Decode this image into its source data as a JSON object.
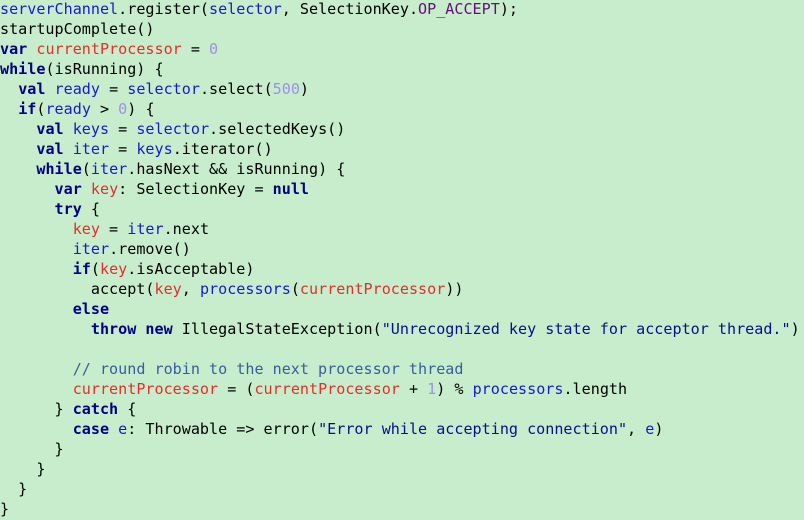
{
  "code_lines": [
    [
      {
        "t": "serverChannel",
        "c": "id"
      },
      {
        "t": ".register(",
        "c": "plain"
      },
      {
        "t": "selector",
        "c": "id"
      },
      {
        "t": ", SelectionKey.",
        "c": "plain"
      },
      {
        "t": "OP_ACCEPT",
        "c": "fld"
      },
      {
        "t": ");",
        "c": "plain"
      }
    ],
    [
      {
        "t": "startupComplete()",
        "c": "plain"
      }
    ],
    [
      {
        "t": "var ",
        "c": "kw"
      },
      {
        "t": "currentProcessor",
        "c": "var"
      },
      {
        "t": " = ",
        "c": "plain"
      },
      {
        "t": "0",
        "c": "num"
      }
    ],
    [
      {
        "t": "while",
        "c": "kw"
      },
      {
        "t": "(isRunning) {",
        "c": "plain"
      }
    ],
    [
      {
        "t": "  ",
        "c": "plain"
      },
      {
        "t": "val ",
        "c": "kw"
      },
      {
        "t": "ready",
        "c": "id"
      },
      {
        "t": " = ",
        "c": "plain"
      },
      {
        "t": "selector",
        "c": "id"
      },
      {
        "t": ".select(",
        "c": "plain"
      },
      {
        "t": "500",
        "c": "num"
      },
      {
        "t": ")",
        "c": "plain"
      }
    ],
    [
      {
        "t": "  ",
        "c": "plain"
      },
      {
        "t": "if",
        "c": "kw"
      },
      {
        "t": "(",
        "c": "plain"
      },
      {
        "t": "ready",
        "c": "id"
      },
      {
        "t": " > ",
        "c": "plain"
      },
      {
        "t": "0",
        "c": "num"
      },
      {
        "t": ") {",
        "c": "plain"
      }
    ],
    [
      {
        "t": "    ",
        "c": "plain"
      },
      {
        "t": "val ",
        "c": "kw"
      },
      {
        "t": "keys",
        "c": "id"
      },
      {
        "t": " = ",
        "c": "plain"
      },
      {
        "t": "selector",
        "c": "id"
      },
      {
        "t": ".selectedKeys()",
        "c": "plain"
      }
    ],
    [
      {
        "t": "    ",
        "c": "plain"
      },
      {
        "t": "val ",
        "c": "kw"
      },
      {
        "t": "iter",
        "c": "id"
      },
      {
        "t": " = ",
        "c": "plain"
      },
      {
        "t": "keys",
        "c": "id"
      },
      {
        "t": ".iterator()",
        "c": "plain"
      }
    ],
    [
      {
        "t": "    ",
        "c": "plain"
      },
      {
        "t": "while",
        "c": "kw"
      },
      {
        "t": "(",
        "c": "plain"
      },
      {
        "t": "iter",
        "c": "id"
      },
      {
        "t": ".hasNext && isRunning) {",
        "c": "plain"
      }
    ],
    [
      {
        "t": "      ",
        "c": "plain"
      },
      {
        "t": "var ",
        "c": "kw"
      },
      {
        "t": "key",
        "c": "var"
      },
      {
        "t": ": SelectionKey = ",
        "c": "plain"
      },
      {
        "t": "null",
        "c": "kw"
      }
    ],
    [
      {
        "t": "      ",
        "c": "plain"
      },
      {
        "t": "try",
        "c": "kw"
      },
      {
        "t": " {",
        "c": "plain"
      }
    ],
    [
      {
        "t": "        ",
        "c": "plain"
      },
      {
        "t": "key",
        "c": "var"
      },
      {
        "t": " = ",
        "c": "plain"
      },
      {
        "t": "iter",
        "c": "id"
      },
      {
        "t": ".next",
        "c": "plain"
      }
    ],
    [
      {
        "t": "        ",
        "c": "plain"
      },
      {
        "t": "iter",
        "c": "id"
      },
      {
        "t": ".remove()",
        "c": "plain"
      }
    ],
    [
      {
        "t": "        ",
        "c": "plain"
      },
      {
        "t": "if",
        "c": "kw"
      },
      {
        "t": "(",
        "c": "plain"
      },
      {
        "t": "key",
        "c": "var"
      },
      {
        "t": ".isAcceptable)",
        "c": "plain"
      }
    ],
    [
      {
        "t": "          ",
        "c": "plain"
      },
      {
        "t": "accept(",
        "c": "plain"
      },
      {
        "t": "key",
        "c": "var"
      },
      {
        "t": ", ",
        "c": "plain"
      },
      {
        "t": "processors",
        "c": "id"
      },
      {
        "t": "(",
        "c": "plain"
      },
      {
        "t": "currentProcessor",
        "c": "var"
      },
      {
        "t": "))",
        "c": "plain"
      }
    ],
    [
      {
        "t": "        ",
        "c": "plain"
      },
      {
        "t": "else",
        "c": "kw"
      }
    ],
    [
      {
        "t": "          ",
        "c": "plain"
      },
      {
        "t": "throw ",
        "c": "kw"
      },
      {
        "t": "new ",
        "c": "kw"
      },
      {
        "t": "IllegalStateException(",
        "c": "plain"
      },
      {
        "t": "\"Unrecognized key state for acceptor thread.\"",
        "c": "str"
      },
      {
        "t": ")",
        "c": "plain"
      }
    ],
    [
      {
        "t": "",
        "c": "plain"
      }
    ],
    [
      {
        "t": "        ",
        "c": "plain"
      },
      {
        "t": "// round robin to the next processor thread",
        "c": "cmt"
      }
    ],
    [
      {
        "t": "        ",
        "c": "plain"
      },
      {
        "t": "currentProcessor",
        "c": "var"
      },
      {
        "t": " = (",
        "c": "plain"
      },
      {
        "t": "currentProcessor",
        "c": "var"
      },
      {
        "t": " + ",
        "c": "plain"
      },
      {
        "t": "1",
        "c": "num"
      },
      {
        "t": ") % ",
        "c": "plain"
      },
      {
        "t": "processors",
        "c": "id"
      },
      {
        "t": ".length",
        "c": "plain"
      }
    ],
    [
      {
        "t": "      } ",
        "c": "plain"
      },
      {
        "t": "catch",
        "c": "kw"
      },
      {
        "t": " {",
        "c": "plain"
      }
    ],
    [
      {
        "t": "        ",
        "c": "plain"
      },
      {
        "t": "case ",
        "c": "kw"
      },
      {
        "t": "e",
        "c": "id"
      },
      {
        "t": ": Throwable => error(",
        "c": "plain"
      },
      {
        "t": "\"Error while accepting connection\"",
        "c": "str"
      },
      {
        "t": ", ",
        "c": "plain"
      },
      {
        "t": "e",
        "c": "id"
      },
      {
        "t": ")",
        "c": "plain"
      }
    ],
    [
      {
        "t": "      }",
        "c": "plain"
      }
    ],
    [
      {
        "t": "    }",
        "c": "plain"
      }
    ],
    [
      {
        "t": "  }",
        "c": "plain"
      }
    ],
    [
      {
        "t": "}",
        "c": "plain"
      }
    ]
  ],
  "colors": {
    "background": "#c7edcc",
    "keyword": "#000080",
    "field": "#660e7a",
    "identifier": "#1c18c8",
    "local_var": "#e0302c",
    "number": "#a090e8",
    "string": "#0a0e8a",
    "comment": "#3a5c9c"
  }
}
